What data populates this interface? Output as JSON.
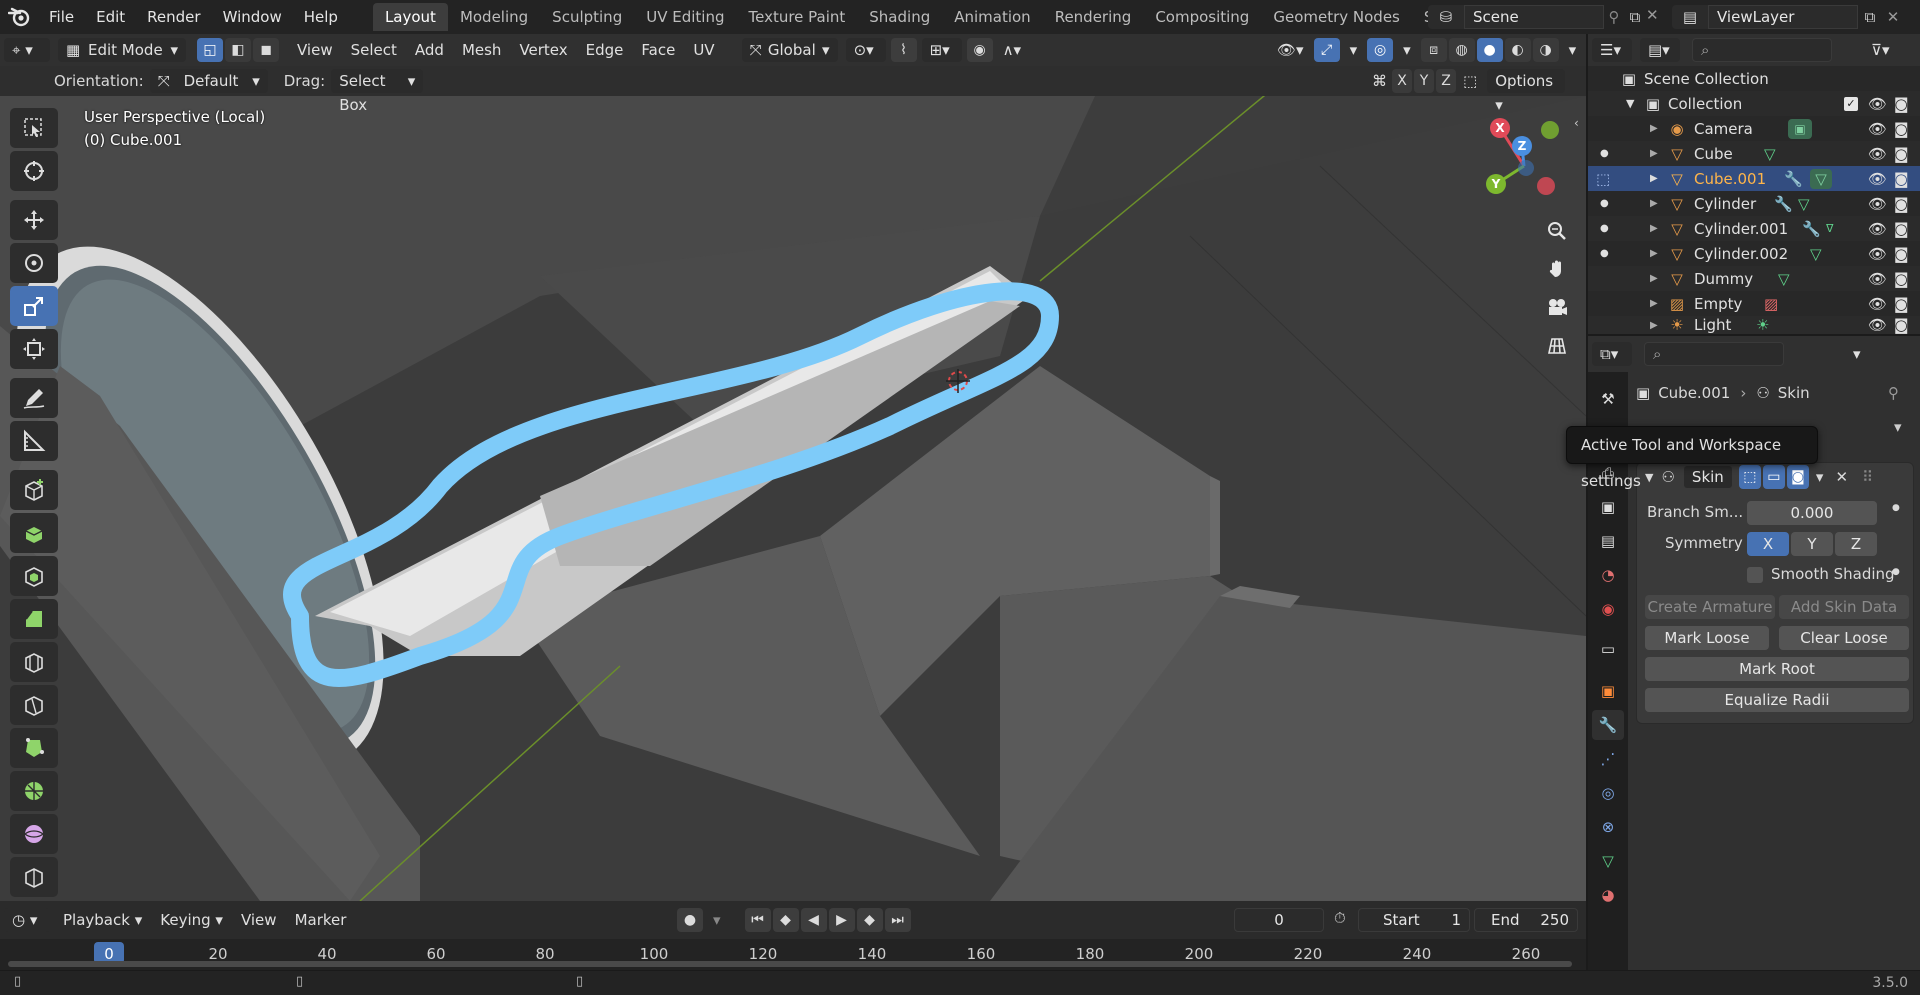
{
  "topbar": {
    "menu": [
      "File",
      "Edit",
      "Render",
      "Window",
      "Help"
    ],
    "workspaces": [
      "Layout",
      "Modeling",
      "Sculpting",
      "UV Editing",
      "Texture Paint",
      "Shading",
      "Animation",
      "Rendering",
      "Compositing",
      "Geometry Nodes",
      "Scripting"
    ],
    "active_workspace": "Layout",
    "scene": "Scene",
    "view_layer": "ViewLayer"
  },
  "view_header": {
    "mode": "Edit Mode",
    "menus": [
      "View",
      "Select",
      "Add",
      "Mesh",
      "Vertex",
      "Edge",
      "Face",
      "UV"
    ],
    "transform_orientation": "Global"
  },
  "tool_header": {
    "orientation_label": "Orientation:",
    "orientation_value": "Default",
    "drag_label": "Drag:",
    "drag_value": "Select Box",
    "axes": [
      "X",
      "Y",
      "Z"
    ],
    "options_label": "Options"
  },
  "viewport": {
    "perspective_label": "User Perspective (Local)",
    "object_label": "(0) Cube.001",
    "gizmo": {
      "x": "X",
      "y": "Y",
      "z": "Z"
    },
    "colors": {
      "background": "#3d3d3d",
      "highlight_stroke": "#7ecbf9",
      "grid_line": "#6b8f2a"
    }
  },
  "timeline": {
    "menus": [
      "Playback",
      "Keying",
      "View",
      "Marker"
    ],
    "current_frame": "0",
    "start_label": "Start",
    "start_value": "1",
    "end_label": "End",
    "end_value": "250",
    "ruler_ticks": [
      "0",
      "20",
      "40",
      "60",
      "80",
      "100",
      "120",
      "140",
      "160",
      "180",
      "200",
      "220",
      "240",
      "260"
    ]
  },
  "outliner": {
    "root": "Scene Collection",
    "collection": "Collection",
    "items": [
      {
        "name": "Camera",
        "selected": false
      },
      {
        "name": "Cube",
        "selected": false
      },
      {
        "name": "Cube.001",
        "selected": true
      },
      {
        "name": "Cylinder",
        "selected": false
      },
      {
        "name": "Cylinder.001",
        "selected": false
      },
      {
        "name": "Cylinder.002",
        "selected": false
      },
      {
        "name": "Dummy",
        "selected": false
      },
      {
        "name": "Empty",
        "selected": false
      },
      {
        "name": "Light",
        "selected": false
      }
    ]
  },
  "properties": {
    "breadcrumb_object": "Cube.001",
    "breadcrumb_modifier": "Skin",
    "tooltip": "Active Tool and Workspace settings",
    "modifier": {
      "name": "Skin",
      "branch_label": "Branch Sm...",
      "branch_value": "0.000",
      "symmetry_label": "Symmetry",
      "symmetry_axes": [
        "X",
        "Y",
        "Z"
      ],
      "smooth_shading": "Smooth Shading",
      "create_armature": "Create Armature",
      "add_skin_data": "Add Skin Data",
      "mark_loose": "Mark Loose",
      "clear_loose": "Clear Loose",
      "mark_root": "Mark Root",
      "equalize_radii": "Equalize Radii"
    }
  },
  "status": {
    "version": "3.5.0"
  }
}
